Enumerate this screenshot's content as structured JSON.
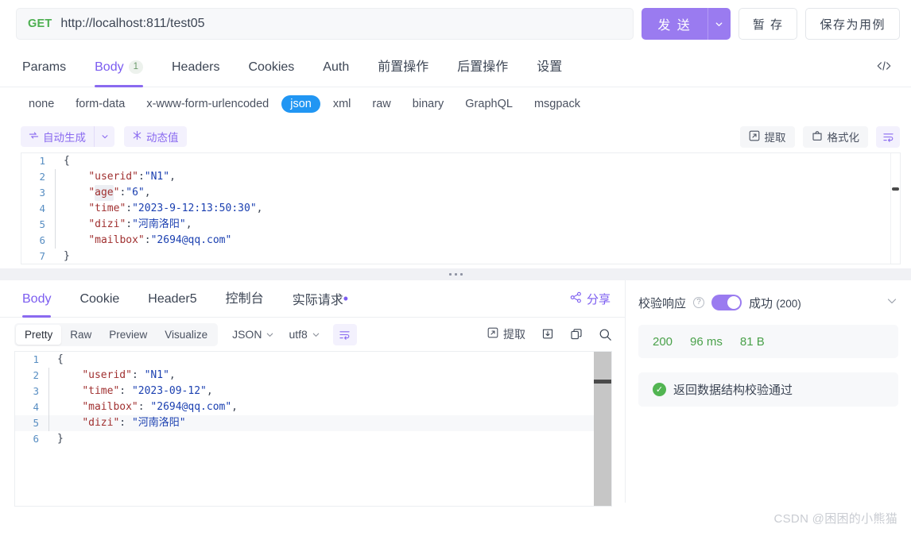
{
  "request": {
    "method": "GET",
    "url": "http://localhost:811/test05",
    "send_label": "发 送",
    "save_draft_label": "暂 存",
    "save_as_case_label": "保存为用例",
    "caret_icon": "chevron-down-icon"
  },
  "main_tabs": [
    {
      "label": "Params",
      "badge": "",
      "active": false
    },
    {
      "label": "Body",
      "badge": "1",
      "active": true
    },
    {
      "label": "Headers",
      "badge": "",
      "active": false
    },
    {
      "label": "Cookies",
      "badge": "",
      "active": false
    },
    {
      "label": "Auth",
      "badge": "",
      "active": false
    },
    {
      "label": "前置操作",
      "badge": "",
      "active": false
    },
    {
      "label": "后置操作",
      "badge": "",
      "active": false
    },
    {
      "label": "设置",
      "badge": "",
      "active": false
    }
  ],
  "code_view_icon": "code-brackets-icon",
  "body_types": [
    {
      "label": "none",
      "active": false
    },
    {
      "label": "form-data",
      "active": false
    },
    {
      "label": "x-www-form-urlencoded",
      "active": false
    },
    {
      "label": "json",
      "active": true
    },
    {
      "label": "xml",
      "active": false
    },
    {
      "label": "raw",
      "active": false
    },
    {
      "label": "binary",
      "active": false
    },
    {
      "label": "GraphQL",
      "active": false
    },
    {
      "label": "msgpack",
      "active": false
    }
  ],
  "editor_toolbar": {
    "auto_generate_label": "自动生成",
    "auto_generate_icon": "refresh-icon",
    "dynamic_value_label": "动态值",
    "dynamic_value_icon": "sparkle-icon",
    "extract_label": "提取",
    "extract_icon": "extract-box-icon",
    "format_label": "格式化",
    "format_icon": "format-box-icon",
    "wrap_icon": "wrap-lines-icon"
  },
  "request_body": {
    "lines": [
      {
        "num": "1",
        "guide": false,
        "tokens": [
          {
            "t": "{",
            "c": "p"
          }
        ]
      },
      {
        "num": "2",
        "guide": true,
        "tokens": [
          {
            "t": "    ",
            "c": "p"
          },
          {
            "t": "\"userid\"",
            "c": "k"
          },
          {
            "t": ":",
            "c": "p"
          },
          {
            "t": "\"N1\"",
            "c": "s"
          },
          {
            "t": ",",
            "c": "p"
          }
        ]
      },
      {
        "num": "3",
        "guide": true,
        "tokens": [
          {
            "t": "    ",
            "c": "p"
          },
          {
            "t": "\"",
            "c": "k"
          },
          {
            "t": "age",
            "c": "k hl-token"
          },
          {
            "t": "\"",
            "c": "k"
          },
          {
            "t": ":",
            "c": "p"
          },
          {
            "t": "\"6\"",
            "c": "s"
          },
          {
            "t": ",",
            "c": "p"
          }
        ]
      },
      {
        "num": "4",
        "guide": true,
        "tokens": [
          {
            "t": "    ",
            "c": "p"
          },
          {
            "t": "\"time\"",
            "c": "k"
          },
          {
            "t": ":",
            "c": "p"
          },
          {
            "t": "\"2023-9-12:13:50:30\"",
            "c": "s"
          },
          {
            "t": ",",
            "c": "p"
          }
        ]
      },
      {
        "num": "5",
        "guide": true,
        "tokens": [
          {
            "t": "    ",
            "c": "p"
          },
          {
            "t": "\"dizi\"",
            "c": "k"
          },
          {
            "t": ":",
            "c": "p"
          },
          {
            "t": "\"河南洛阳\"",
            "c": "s"
          },
          {
            "t": ",",
            "c": "p"
          }
        ]
      },
      {
        "num": "6",
        "guide": true,
        "tokens": [
          {
            "t": "    ",
            "c": "p"
          },
          {
            "t": "\"mailbox\"",
            "c": "k"
          },
          {
            "t": ":",
            "c": "p"
          },
          {
            "t": "\"2694@qq.com\"",
            "c": "s"
          }
        ]
      },
      {
        "num": "7",
        "guide": false,
        "tokens": [
          {
            "t": "}",
            "c": "p"
          }
        ]
      }
    ]
  },
  "response_tabs": [
    {
      "label": "Body",
      "badge": "",
      "dot": false,
      "active": true
    },
    {
      "label": "Cookie",
      "badge": "",
      "dot": false,
      "active": false
    },
    {
      "label": "Header",
      "badge": "5",
      "dot": false,
      "active": false
    },
    {
      "label": "控制台",
      "badge": "",
      "dot": false,
      "active": false
    },
    {
      "label": "实际请求",
      "badge": "",
      "dot": true,
      "active": false
    }
  ],
  "share": {
    "label": "分享",
    "icon": "share-nodes-icon"
  },
  "response_toolbar": {
    "segments": [
      {
        "label": "Pretty",
        "active": true
      },
      {
        "label": "Raw",
        "active": false
      },
      {
        "label": "Preview",
        "active": false
      },
      {
        "label": "Visualize",
        "active": false
      }
    ],
    "format_select": "JSON",
    "encoding_select": "utf8",
    "wrap_icon": "wrap-lines-icon",
    "extract_label": "提取",
    "extract_icon": "extract-box-icon",
    "download_icon": "download-icon",
    "copy_icon": "copy-icon",
    "search_icon": "search-icon"
  },
  "response_body": {
    "lines": [
      {
        "num": "1",
        "guide": false,
        "hl": false,
        "tokens": [
          {
            "t": "{",
            "c": "p"
          }
        ]
      },
      {
        "num": "2",
        "guide": true,
        "hl": false,
        "tokens": [
          {
            "t": "    ",
            "c": "p"
          },
          {
            "t": "\"userid\"",
            "c": "k"
          },
          {
            "t": ": ",
            "c": "p"
          },
          {
            "t": "\"N1\"",
            "c": "s"
          },
          {
            "t": ",",
            "c": "p"
          }
        ]
      },
      {
        "num": "3",
        "guide": true,
        "hl": false,
        "tokens": [
          {
            "t": "    ",
            "c": "p"
          },
          {
            "t": "\"time\"",
            "c": "k"
          },
          {
            "t": ": ",
            "c": "p"
          },
          {
            "t": "\"2023-09-12\"",
            "c": "s"
          },
          {
            "t": ",",
            "c": "p"
          }
        ]
      },
      {
        "num": "4",
        "guide": true,
        "hl": false,
        "tokens": [
          {
            "t": "    ",
            "c": "p"
          },
          {
            "t": "\"mailbox\"",
            "c": "k"
          },
          {
            "t": ": ",
            "c": "p"
          },
          {
            "t": "\"2694@qq.com\"",
            "c": "s"
          },
          {
            "t": ",",
            "c": "p"
          }
        ]
      },
      {
        "num": "5",
        "guide": true,
        "hl": true,
        "tokens": [
          {
            "t": "    ",
            "c": "p"
          },
          {
            "t": "\"dizi\"",
            "c": "k"
          },
          {
            "t": ": ",
            "c": "p"
          },
          {
            "t": "\"河南洛阳\"",
            "c": "s"
          }
        ]
      },
      {
        "num": "6",
        "guide": false,
        "hl": false,
        "tokens": [
          {
            "t": "}",
            "c": "p"
          }
        ]
      }
    ]
  },
  "verify": {
    "label": "校验响应",
    "help_icon": "question-circle-icon",
    "toggle_on": true,
    "status": "成功",
    "status_code": "(200)",
    "collapse_icon": "chevron-down-icon",
    "stats": {
      "code": "200",
      "time": "96 ms",
      "size": "81 B"
    },
    "pass_icon": "check-circle-icon",
    "pass_text": "返回数据结构校验通过"
  },
  "watermark": "CSDN @困困的小熊猫",
  "colors": {
    "accent_purple": "#8a6af0",
    "send_purple": "#9a7bf0",
    "json_blue": "#2196f3",
    "success_green": "#4aa14a",
    "method_green": "#4caf50"
  }
}
